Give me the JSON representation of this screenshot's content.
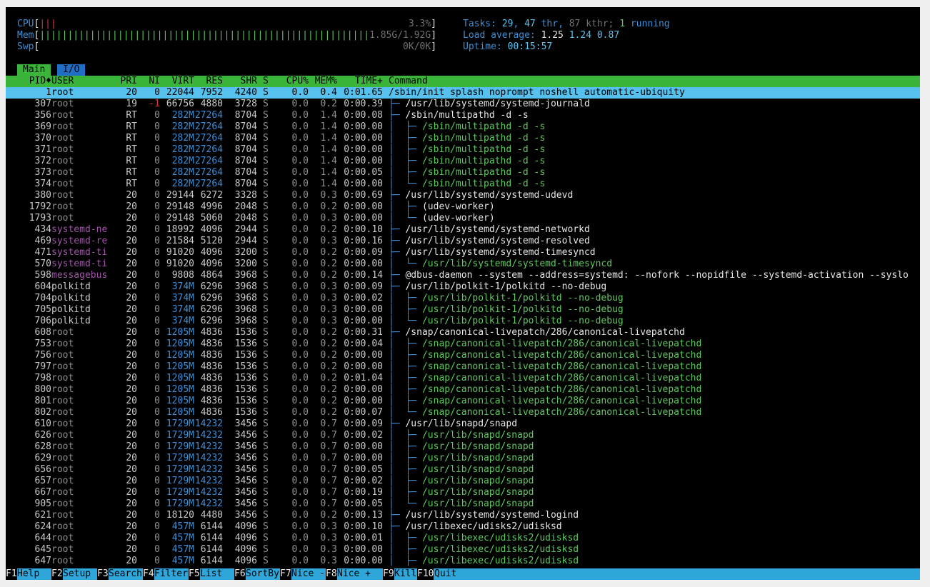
{
  "header": {
    "cpu": {
      "label": "CPU",
      "bar": "|||",
      "value": "3.3%"
    },
    "mem": {
      "label": "Mem",
      "bar": "|||||||||||||||||||||||||||||||||||||||||||||||||||||||||||",
      "value": "1.85G/1.92G"
    },
    "swp": {
      "label": "Swp",
      "bar": "",
      "value": "0K/0K"
    },
    "tasks": {
      "label": "Tasks:",
      "tasks": "29",
      "thr": "47",
      "thr_label": "thr,",
      "kthr": "87",
      "kthr_label": "kthr;",
      "running": "1",
      "running_label": "running"
    },
    "load": {
      "label": "Load average:",
      "one": "1.25",
      "five": "1.24",
      "fifteen": "0.87"
    },
    "uptime": {
      "label": "Uptime:",
      "value": "00:15:57"
    }
  },
  "tabs": [
    {
      "label": "Main"
    },
    {
      "label": "I/O"
    }
  ],
  "columns": [
    "PID♦",
    "USER",
    "PRI",
    "NI",
    "VIRT",
    "RES",
    "SHR",
    "S",
    "CPU%",
    "MEM%",
    "TIME+",
    "Command"
  ],
  "processes": [
    {
      "pid": "1",
      "user": "root",
      "pri": "20",
      "ni": "0",
      "virt": "22044",
      "res": "7952",
      "shr": "4240",
      "s": "S",
      "cpu": "0.0",
      "mem": "0.4",
      "time": "0:01.65",
      "tree": "",
      "cmd": "/sbin/init splash noprompt noshell automatic-ubiquity",
      "thread": false
    },
    {
      "pid": "307",
      "user": "root",
      "pri": "19",
      "ni": "-1",
      "virt": "66756",
      "res": "4880",
      "shr": "3728",
      "s": "S",
      "cpu": "0.0",
      "mem": "0.2",
      "time": "0:00.39",
      "tree": "├─ ",
      "cmd": "/usr/lib/systemd/systemd-journald",
      "thread": false
    },
    {
      "pid": "356",
      "user": "root",
      "pri": "RT",
      "ni": "0",
      "virt": "282M",
      "res": "27264",
      "shr": "8704",
      "s": "S",
      "cpu": "0.0",
      "mem": "1.4",
      "time": "0:00.08",
      "tree": "├─ ",
      "cmd": "/sbin/multipathd -d -s",
      "thread": false
    },
    {
      "pid": "369",
      "user": "root",
      "pri": "RT",
      "ni": "0",
      "virt": "282M",
      "res": "27264",
      "shr": "8704",
      "s": "S",
      "cpu": "0.0",
      "mem": "1.4",
      "time": "0:00.00",
      "tree": "│  ├─ ",
      "cmd": "/sbin/multipathd -d -s",
      "thread": true
    },
    {
      "pid": "370",
      "user": "root",
      "pri": "RT",
      "ni": "0",
      "virt": "282M",
      "res": "27264",
      "shr": "8704",
      "s": "S",
      "cpu": "0.0",
      "mem": "1.4",
      "time": "0:00.00",
      "tree": "│  ├─ ",
      "cmd": "/sbin/multipathd -d -s",
      "thread": true
    },
    {
      "pid": "371",
      "user": "root",
      "pri": "RT",
      "ni": "0",
      "virt": "282M",
      "res": "27264",
      "shr": "8704",
      "s": "S",
      "cpu": "0.0",
      "mem": "1.4",
      "time": "0:00.00",
      "tree": "│  ├─ ",
      "cmd": "/sbin/multipathd -d -s",
      "thread": true
    },
    {
      "pid": "372",
      "user": "root",
      "pri": "RT",
      "ni": "0",
      "virt": "282M",
      "res": "27264",
      "shr": "8704",
      "s": "S",
      "cpu": "0.0",
      "mem": "1.4",
      "time": "0:00.00",
      "tree": "│  ├─ ",
      "cmd": "/sbin/multipathd -d -s",
      "thread": true
    },
    {
      "pid": "373",
      "user": "root",
      "pri": "RT",
      "ni": "0",
      "virt": "282M",
      "res": "27264",
      "shr": "8704",
      "s": "S",
      "cpu": "0.0",
      "mem": "1.4",
      "time": "0:00.05",
      "tree": "│  ├─ ",
      "cmd": "/sbin/multipathd -d -s",
      "thread": true
    },
    {
      "pid": "374",
      "user": "root",
      "pri": "RT",
      "ni": "0",
      "virt": "282M",
      "res": "27264",
      "shr": "8704",
      "s": "S",
      "cpu": "0.0",
      "mem": "1.4",
      "time": "0:00.00",
      "tree": "│  └─ ",
      "cmd": "/sbin/multipathd -d -s",
      "thread": true
    },
    {
      "pid": "380",
      "user": "root",
      "pri": "20",
      "ni": "0",
      "virt": "29144",
      "res": "6272",
      "shr": "3328",
      "s": "S",
      "cpu": "0.0",
      "mem": "0.3",
      "time": "0:00.69",
      "tree": "├─ ",
      "cmd": "/usr/lib/systemd/systemd-udevd",
      "thread": false
    },
    {
      "pid": "1792",
      "user": "root",
      "pri": "20",
      "ni": "0",
      "virt": "29148",
      "res": "4996",
      "shr": "2048",
      "s": "S",
      "cpu": "0.0",
      "mem": "0.2",
      "time": "0:00.00",
      "tree": "│  ├─ ",
      "cmd": "(udev-worker)",
      "thread": false
    },
    {
      "pid": "1793",
      "user": "root",
      "pri": "20",
      "ni": "0",
      "virt": "29148",
      "res": "5060",
      "shr": "2048",
      "s": "S",
      "cpu": "0.0",
      "mem": "0.3",
      "time": "0:00.00",
      "tree": "│  └─ ",
      "cmd": "(udev-worker)",
      "thread": false
    },
    {
      "pid": "434",
      "user": "systemd-ne",
      "pri": "20",
      "ni": "0",
      "virt": "18992",
      "res": "4096",
      "shr": "2944",
      "s": "S",
      "cpu": "0.0",
      "mem": "0.2",
      "time": "0:00.10",
      "tree": "├─ ",
      "cmd": "/usr/lib/systemd/systemd-networkd",
      "thread": false
    },
    {
      "pid": "469",
      "user": "systemd-re",
      "pri": "20",
      "ni": "0",
      "virt": "21584",
      "res": "5120",
      "shr": "2944",
      "s": "S",
      "cpu": "0.0",
      "mem": "0.3",
      "time": "0:00.16",
      "tree": "├─ ",
      "cmd": "/usr/lib/systemd/systemd-resolved",
      "thread": false
    },
    {
      "pid": "471",
      "user": "systemd-ti",
      "pri": "20",
      "ni": "0",
      "virt": "91020",
      "res": "4096",
      "shr": "3200",
      "s": "S",
      "cpu": "0.0",
      "mem": "0.2",
      "time": "0:00.09",
      "tree": "├─ ",
      "cmd": "/usr/lib/systemd/systemd-timesyncd",
      "thread": false
    },
    {
      "pid": "570",
      "user": "systemd-ti",
      "pri": "20",
      "ni": "0",
      "virt": "91020",
      "res": "4096",
      "shr": "3200",
      "s": "S",
      "cpu": "0.0",
      "mem": "0.2",
      "time": "0:00.00",
      "tree": "│  └─ ",
      "cmd": "/usr/lib/systemd/systemd-timesyncd",
      "thread": true
    },
    {
      "pid": "598",
      "user": "messagebus",
      "pri": "20",
      "ni": "0",
      "virt": "9808",
      "res": "4864",
      "shr": "3968",
      "s": "S",
      "cpu": "0.0",
      "mem": "0.2",
      "time": "0:00.14",
      "tree": "├─ ",
      "cmd": "@dbus-daemon --system --address=systemd: --nofork --nopidfile --systemd-activation --syslo",
      "thread": false
    },
    {
      "pid": "604",
      "user": "polkitd",
      "pri": "20",
      "ni": "0",
      "virt": "374M",
      "res": "6296",
      "shr": "3968",
      "s": "S",
      "cpu": "0.0",
      "mem": "0.3",
      "time": "0:00.09",
      "tree": "├─ ",
      "cmd": "/usr/lib/polkit-1/polkitd --no-debug",
      "thread": false
    },
    {
      "pid": "704",
      "user": "polkitd",
      "pri": "20",
      "ni": "0",
      "virt": "374M",
      "res": "6296",
      "shr": "3968",
      "s": "S",
      "cpu": "0.0",
      "mem": "0.3",
      "time": "0:00.02",
      "tree": "│  ├─ ",
      "cmd": "/usr/lib/polkit-1/polkitd --no-debug",
      "thread": true
    },
    {
      "pid": "705",
      "user": "polkitd",
      "pri": "20",
      "ni": "0",
      "virt": "374M",
      "res": "6296",
      "shr": "3968",
      "s": "S",
      "cpu": "0.0",
      "mem": "0.3",
      "time": "0:00.00",
      "tree": "│  ├─ ",
      "cmd": "/usr/lib/polkit-1/polkitd --no-debug",
      "thread": true
    },
    {
      "pid": "706",
      "user": "polkitd",
      "pri": "20",
      "ni": "0",
      "virt": "374M",
      "res": "6296",
      "shr": "3968",
      "s": "S",
      "cpu": "0.0",
      "mem": "0.3",
      "time": "0:00.00",
      "tree": "│  └─ ",
      "cmd": "/usr/lib/polkit-1/polkitd --no-debug",
      "thread": true
    },
    {
      "pid": "608",
      "user": "root",
      "pri": "20",
      "ni": "0",
      "virt": "1205M",
      "res": "4836",
      "shr": "1536",
      "s": "S",
      "cpu": "0.0",
      "mem": "0.2",
      "time": "0:00.31",
      "tree": "├─ ",
      "cmd": "/snap/canonical-livepatch/286/canonical-livepatchd",
      "thread": false
    },
    {
      "pid": "753",
      "user": "root",
      "pri": "20",
      "ni": "0",
      "virt": "1205M",
      "res": "4836",
      "shr": "1536",
      "s": "S",
      "cpu": "0.0",
      "mem": "0.2",
      "time": "0:00.04",
      "tree": "│  ├─ ",
      "cmd": "/snap/canonical-livepatch/286/canonical-livepatchd",
      "thread": true
    },
    {
      "pid": "756",
      "user": "root",
      "pri": "20",
      "ni": "0",
      "virt": "1205M",
      "res": "4836",
      "shr": "1536",
      "s": "S",
      "cpu": "0.0",
      "mem": "0.2",
      "time": "0:00.00",
      "tree": "│  ├─ ",
      "cmd": "/snap/canonical-livepatch/286/canonical-livepatchd",
      "thread": true
    },
    {
      "pid": "797",
      "user": "root",
      "pri": "20",
      "ni": "0",
      "virt": "1205M",
      "res": "4836",
      "shr": "1536",
      "s": "S",
      "cpu": "0.0",
      "mem": "0.2",
      "time": "0:00.00",
      "tree": "│  ├─ ",
      "cmd": "/snap/canonical-livepatch/286/canonical-livepatchd",
      "thread": true
    },
    {
      "pid": "798",
      "user": "root",
      "pri": "20",
      "ni": "0",
      "virt": "1205M",
      "res": "4836",
      "shr": "1536",
      "s": "S",
      "cpu": "0.0",
      "mem": "0.2",
      "time": "0:01.04",
      "tree": "│  ├─ ",
      "cmd": "/snap/canonical-livepatch/286/canonical-livepatchd",
      "thread": true
    },
    {
      "pid": "800",
      "user": "root",
      "pri": "20",
      "ni": "0",
      "virt": "1205M",
      "res": "4836",
      "shr": "1536",
      "s": "S",
      "cpu": "0.0",
      "mem": "0.2",
      "time": "0:00.00",
      "tree": "│  ├─ ",
      "cmd": "/snap/canonical-livepatch/286/canonical-livepatchd",
      "thread": true
    },
    {
      "pid": "801",
      "user": "root",
      "pri": "20",
      "ni": "0",
      "virt": "1205M",
      "res": "4836",
      "shr": "1536",
      "s": "S",
      "cpu": "0.0",
      "mem": "0.2",
      "time": "0:00.00",
      "tree": "│  ├─ ",
      "cmd": "/snap/canonical-livepatch/286/canonical-livepatchd",
      "thread": true
    },
    {
      "pid": "802",
      "user": "root",
      "pri": "20",
      "ni": "0",
      "virt": "1205M",
      "res": "4836",
      "shr": "1536",
      "s": "S",
      "cpu": "0.0",
      "mem": "0.2",
      "time": "0:00.07",
      "tree": "│  └─ ",
      "cmd": "/snap/canonical-livepatch/286/canonical-livepatchd",
      "thread": true
    },
    {
      "pid": "610",
      "user": "root",
      "pri": "20",
      "ni": "0",
      "virt": "1729M",
      "res": "14232",
      "shr": "3456",
      "s": "S",
      "cpu": "0.0",
      "mem": "0.7",
      "time": "0:00.09",
      "tree": "├─ ",
      "cmd": "/usr/lib/snapd/snapd",
      "thread": false
    },
    {
      "pid": "626",
      "user": "root",
      "pri": "20",
      "ni": "0",
      "virt": "1729M",
      "res": "14232",
      "shr": "3456",
      "s": "S",
      "cpu": "0.0",
      "mem": "0.7",
      "time": "0:00.02",
      "tree": "│  ├─ ",
      "cmd": "/usr/lib/snapd/snapd",
      "thread": true
    },
    {
      "pid": "628",
      "user": "root",
      "pri": "20",
      "ni": "0",
      "virt": "1729M",
      "res": "14232",
      "shr": "3456",
      "s": "S",
      "cpu": "0.0",
      "mem": "0.7",
      "time": "0:00.00",
      "tree": "│  ├─ ",
      "cmd": "/usr/lib/snapd/snapd",
      "thread": true
    },
    {
      "pid": "629",
      "user": "root",
      "pri": "20",
      "ni": "0",
      "virt": "1729M",
      "res": "14232",
      "shr": "3456",
      "s": "S",
      "cpu": "0.0",
      "mem": "0.7",
      "time": "0:00.00",
      "tree": "│  ├─ ",
      "cmd": "/usr/lib/snapd/snapd",
      "thread": true
    },
    {
      "pid": "656",
      "user": "root",
      "pri": "20",
      "ni": "0",
      "virt": "1729M",
      "res": "14232",
      "shr": "3456",
      "s": "S",
      "cpu": "0.0",
      "mem": "0.7",
      "time": "0:00.05",
      "tree": "│  ├─ ",
      "cmd": "/usr/lib/snapd/snapd",
      "thread": true
    },
    {
      "pid": "657",
      "user": "root",
      "pri": "20",
      "ni": "0",
      "virt": "1729M",
      "res": "14232",
      "shr": "3456",
      "s": "S",
      "cpu": "0.0",
      "mem": "0.7",
      "time": "0:00.02",
      "tree": "│  ├─ ",
      "cmd": "/usr/lib/snapd/snapd",
      "thread": true
    },
    {
      "pid": "667",
      "user": "root",
      "pri": "20",
      "ni": "0",
      "virt": "1729M",
      "res": "14232",
      "shr": "3456",
      "s": "S",
      "cpu": "0.0",
      "mem": "0.7",
      "time": "0:00.19",
      "tree": "│  ├─ ",
      "cmd": "/usr/lib/snapd/snapd",
      "thread": true
    },
    {
      "pid": "905",
      "user": "root",
      "pri": "20",
      "ni": "0",
      "virt": "1729M",
      "res": "14232",
      "shr": "3456",
      "s": "S",
      "cpu": "0.0",
      "mem": "0.7",
      "time": "0:00.05",
      "tree": "│  └─ ",
      "cmd": "/usr/lib/snapd/snapd",
      "thread": true
    },
    {
      "pid": "621",
      "user": "root",
      "pri": "20",
      "ni": "0",
      "virt": "18120",
      "res": "4480",
      "shr": "3456",
      "s": "S",
      "cpu": "0.0",
      "mem": "0.2",
      "time": "0:00.13",
      "tree": "├─ ",
      "cmd": "/usr/lib/systemd/systemd-logind",
      "thread": false
    },
    {
      "pid": "624",
      "user": "root",
      "pri": "20",
      "ni": "0",
      "virt": "457M",
      "res": "6144",
      "shr": "4096",
      "s": "S",
      "cpu": "0.0",
      "mem": "0.3",
      "time": "0:00.10",
      "tree": "├─ ",
      "cmd": "/usr/libexec/udisks2/udisksd",
      "thread": false
    },
    {
      "pid": "644",
      "user": "root",
      "pri": "20",
      "ni": "0",
      "virt": "457M",
      "res": "6144",
      "shr": "4096",
      "s": "S",
      "cpu": "0.0",
      "mem": "0.3",
      "time": "0:00.01",
      "tree": "│  ├─ ",
      "cmd": "/usr/libexec/udisks2/udisksd",
      "thread": true
    },
    {
      "pid": "645",
      "user": "root",
      "pri": "20",
      "ni": "0",
      "virt": "457M",
      "res": "6144",
      "shr": "4096",
      "s": "S",
      "cpu": "0.0",
      "mem": "0.3",
      "time": "0:00.00",
      "tree": "│  ├─ ",
      "cmd": "/usr/libexec/udisks2/udisksd",
      "thread": true
    },
    {
      "pid": "647",
      "user": "root",
      "pri": "20",
      "ni": "0",
      "virt": "457M",
      "res": "6144",
      "shr": "4096",
      "s": "S",
      "cpu": "0.0",
      "mem": "0.3",
      "time": "0:00.00",
      "tree": "│  ├─ ",
      "cmd": "/usr/libexec/udisks2/udisksd",
      "thread": true
    }
  ],
  "footer": [
    {
      "key": "F1",
      "label": "Help"
    },
    {
      "key": "F2",
      "label": "Setup"
    },
    {
      "key": "F3",
      "label": "Search"
    },
    {
      "key": "F4",
      "label": "Filter"
    },
    {
      "key": "F5",
      "label": "List"
    },
    {
      "key": "F6",
      "label": "SortBy"
    },
    {
      "key": "F7",
      "label": "Nice -"
    },
    {
      "key": "F8",
      "label": "Nice +"
    },
    {
      "key": "F9",
      "label": "Kill"
    },
    {
      "key": "F10",
      "label": "Quit"
    }
  ],
  "colors": {
    "bg": "#000000",
    "header_bar": "#3ab53a",
    "selected": "#55c1ec",
    "footer": "#2fa6d9",
    "label": "#3a8fd6",
    "user_system": "#a054a8",
    "thread": "#5ec85e",
    "neg_nice": "#d23a3a"
  }
}
